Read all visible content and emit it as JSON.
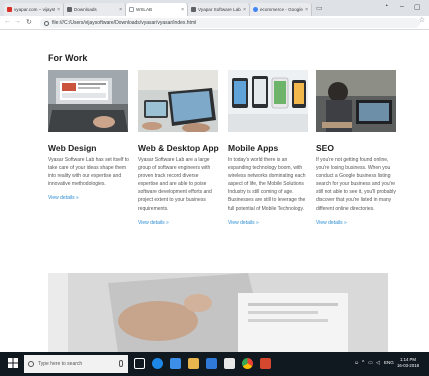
{
  "browser": {
    "tabs": [
      {
        "label": "vyapar.com – vijaystestch",
        "color": "#d93025",
        "active": false
      },
      {
        "label": "Downloads",
        "color": "#5f6368",
        "active": false
      },
      {
        "label": "WSLAB",
        "color": "#9aa0a6",
        "active": true
      },
      {
        "label": "Vyapar Software Lab",
        "color": "#5f6368",
        "active": false
      },
      {
        "label": "ecommerce - Google Se",
        "color": "#4285f4",
        "active": false
      }
    ],
    "address": "file:///C:/Users/vijaysoftware/Downloads/vyasar/vyasar/index.html"
  },
  "page": {
    "section_title": "For Work",
    "cards": [
      {
        "title": "Web Design",
        "description": "Vyasar Software Lab has set itself to take care of your ideas shape them into reality with our expertise and innovative methodologies.",
        "link": "View details »"
      },
      {
        "title": "Web & Desktop App",
        "description": "Vyasar Software Lab are a large group of software engineers with proven track record diverse expertise and are able to poise software development efforts and project extent to your business requirements.",
        "link": "View details »"
      },
      {
        "title": "Mobile Apps",
        "description": "In today's world there is an expanding technology boom, with wireless networks dominating each aspect of life, the Mobile Solutions Industry is still coming of age. Businesses are still to leverage the full potential of Mobile Technology.",
        "link": "View details »"
      },
      {
        "title": "SEO",
        "description": "If you're not getting found online, you're losing business. When you conduct a Google business listing search for your business and you're still not able to see it, you'll probably discover that you're listed in many different online directories.",
        "link": "View details »"
      }
    ]
  },
  "taskbar": {
    "search_placeholder": "Type here to search",
    "lang": "ENG",
    "time": "1:14 PM",
    "date": "16-03-2018"
  }
}
